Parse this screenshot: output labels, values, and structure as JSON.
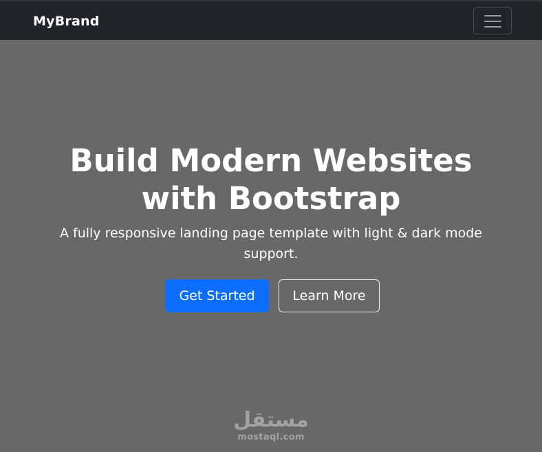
{
  "navbar": {
    "brand": "MyBrand",
    "toggler_icon": "hamburger-menu-icon"
  },
  "hero": {
    "title": "Build Modern Websites with Bootstrap",
    "subtitle": "A fully responsive landing page template with light & dark mode support.",
    "primary_button": "Get Started",
    "secondary_button": "Learn More"
  },
  "watermark": {
    "arabic": "مستقل",
    "latin": "mostaql.com"
  },
  "colors": {
    "navbar_bg": "#212529",
    "hero_bg": "#686868",
    "primary": "#0d6efd",
    "text": "#ffffff"
  }
}
